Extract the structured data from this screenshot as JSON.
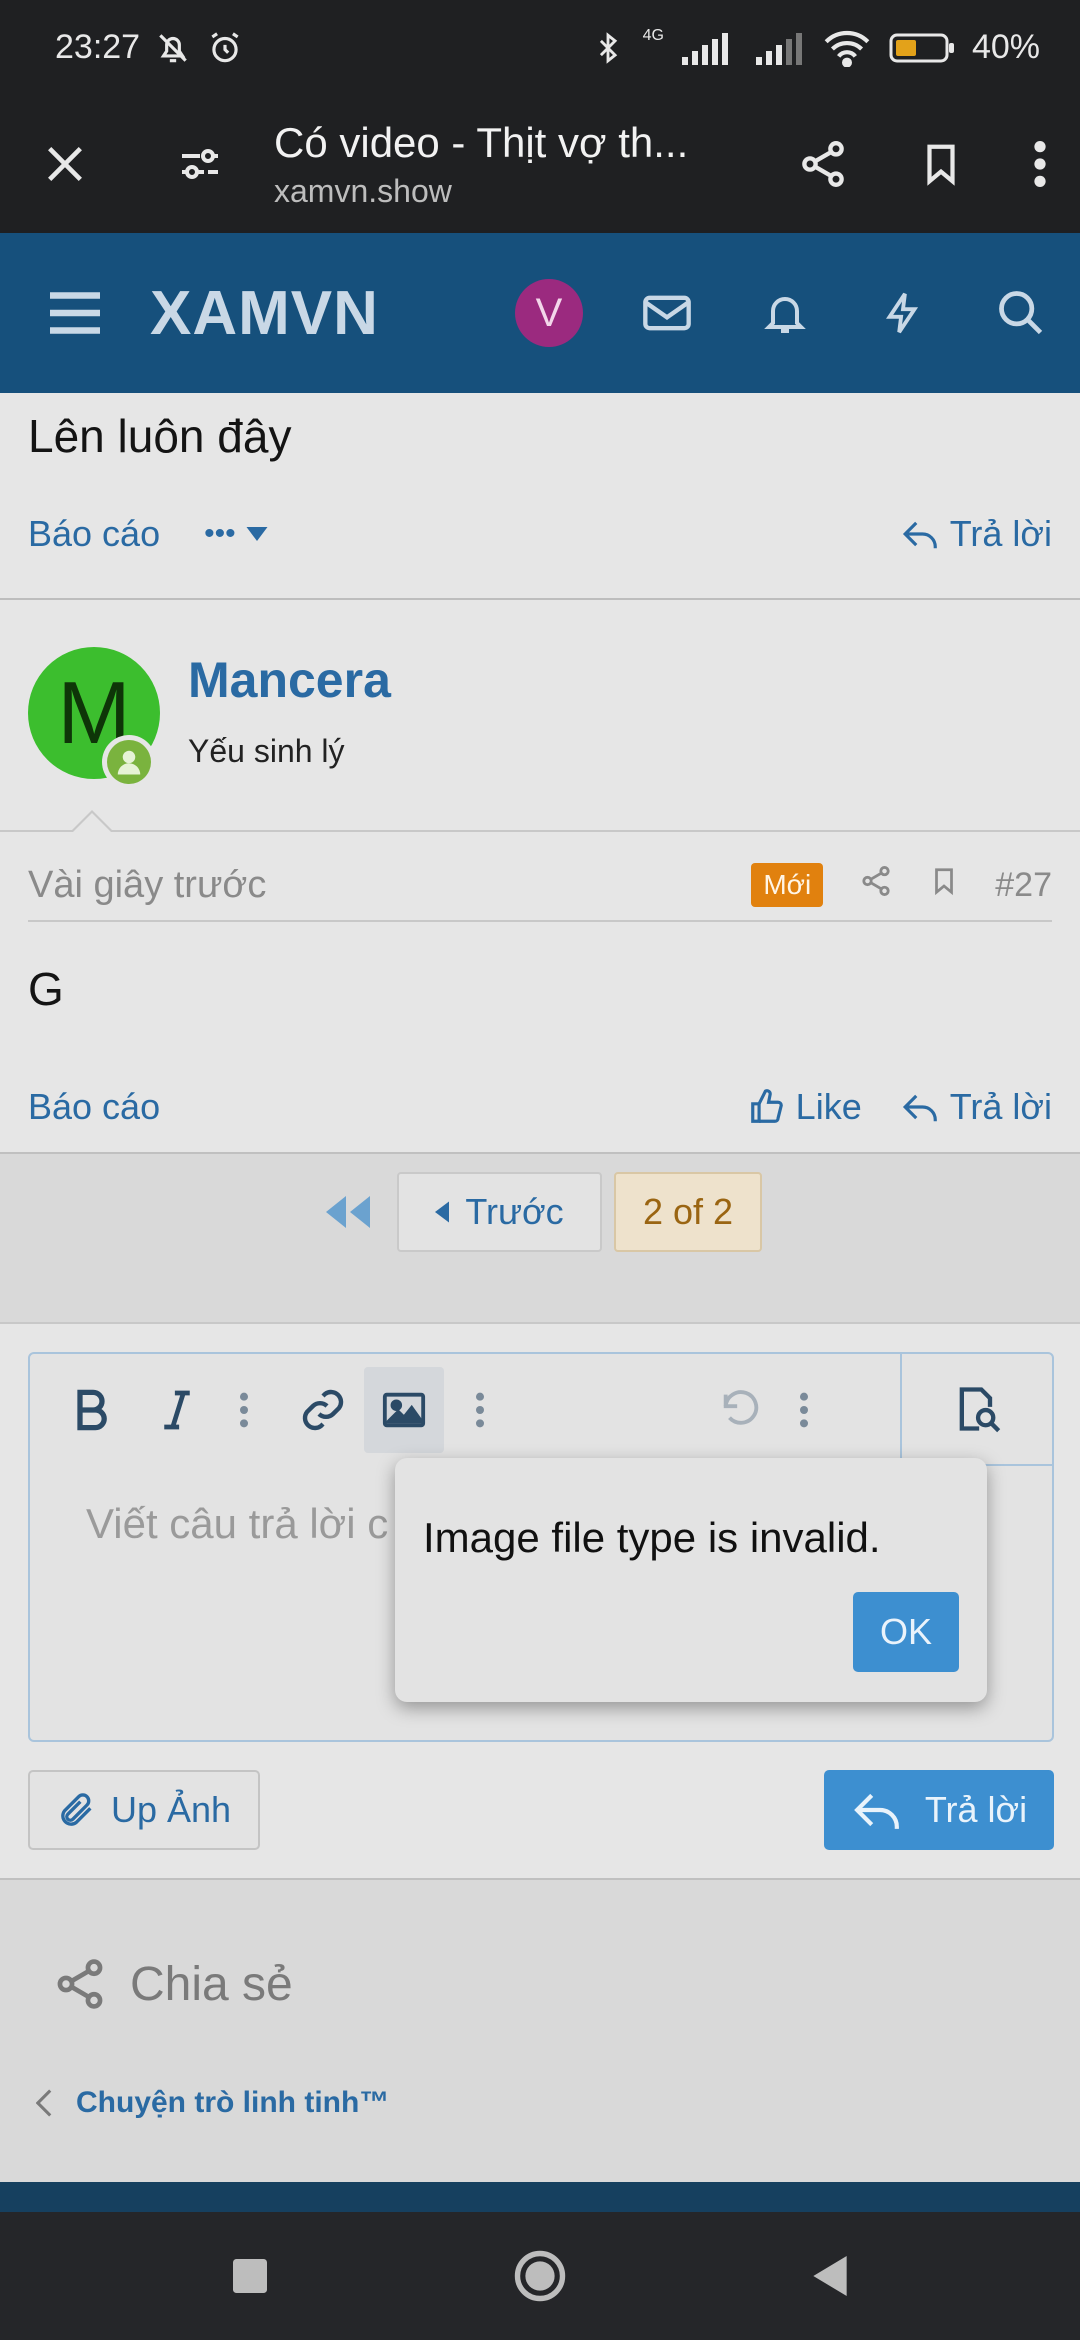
{
  "status_bar": {
    "time": "23:27",
    "network": "4G",
    "battery": "40%"
  },
  "browser": {
    "page_title": "Có video - Thịt vợ th...",
    "domain": "xamvn.show"
  },
  "site": {
    "logo": "XAMVN",
    "avatar_letter": "V",
    "avatar_color": "#9b2a7f",
    "header_color": "#16507c"
  },
  "previous_post": {
    "text": "Lên luôn đây",
    "report_label": "Báo cáo",
    "more_label": "•••",
    "reply_label": "Trả lời"
  },
  "message": {
    "avatar_letter": "M",
    "username": "Mancera",
    "user_title": "Yếu sinh lý",
    "time": "Vài giây trước",
    "new_badge": "Mới",
    "number": "#27",
    "text": "G",
    "report_label": "Báo cáo",
    "like_label": "Like",
    "reply_label": "Trả lời"
  },
  "pagination": {
    "prev_label": "Trước",
    "current": "2 of 2"
  },
  "editor": {
    "placeholder": "Viết câu trả lời c",
    "upload_label": "Up Ảnh",
    "submit_label": "Trả lời",
    "toolbar_icons": [
      "bold-icon",
      "italic-icon",
      "more-vertical-icon",
      "link-icon",
      "image-icon",
      "more-vertical-icon",
      "undo-icon",
      "more-vertical-icon",
      "preview-icon"
    ]
  },
  "dialog": {
    "message": "Image file type is invalid.",
    "ok_label": "OK"
  },
  "share": {
    "label": "Chia sẻ"
  },
  "breadcrumb": {
    "label": "Chuyện trò linh tinh™"
  }
}
